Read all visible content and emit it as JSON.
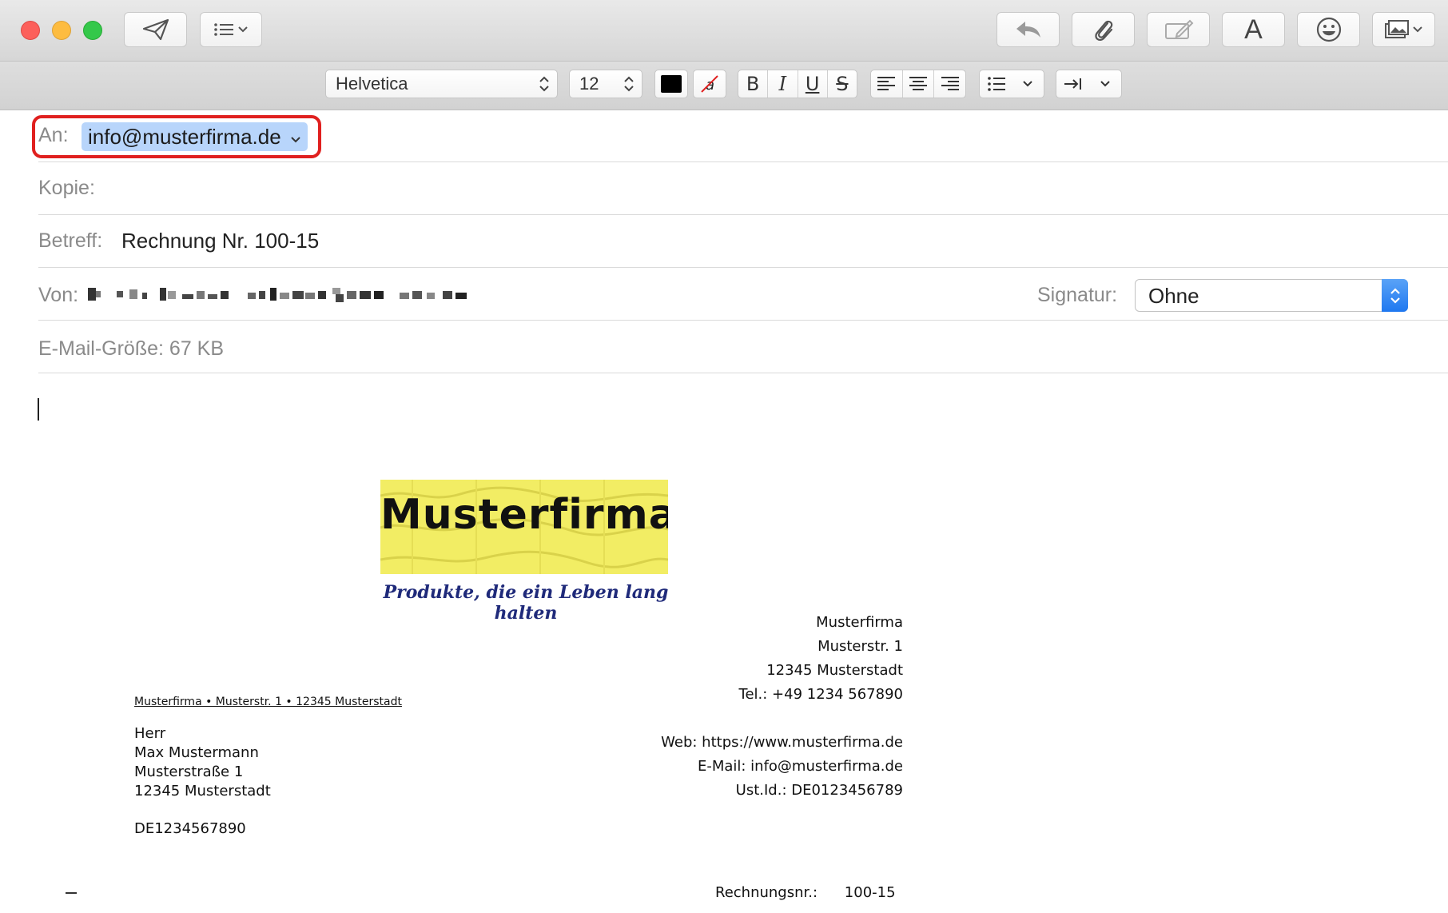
{
  "toolbar": {
    "buttons": [
      "send",
      "header-fields",
      "reply",
      "attach",
      "markup",
      "format",
      "emoji",
      "photo-browser"
    ],
    "format_glyph": "A"
  },
  "format_bar": {
    "font_family": "Helvetica",
    "font_size": "12",
    "text_color": "#000000",
    "bold": "B",
    "italic": "I",
    "underline": "U",
    "strikethrough": "S"
  },
  "header": {
    "to_label": "An:",
    "to_value": "info@musterfirma.de",
    "cc_label": "Kopie:",
    "subject_label": "Betreff:",
    "subject_value": "Rechnung Nr. 100-15",
    "from_label": "Von:",
    "signature_label": "Signatur:",
    "signature_value": "Ohne",
    "size_label": "E-Mail-Größe:",
    "size_value": "67 KB"
  },
  "document": {
    "logo_text": "Musterfirma",
    "tagline": "Produkte, die ein Leben lang halten",
    "company_block": [
      "Musterfirma",
      "Musterstr. 1",
      "12345 Musterstadt",
      "Tel.: +49 1234 567890"
    ],
    "contact_block": [
      "Web: https://www.musterfirma.de",
      "E-Mail: info@musterfirma.de",
      "Ust.Id.: DE0123456789"
    ],
    "sender_line": "Musterfirma • Musterstr. 1 • 12345 Musterstadt",
    "recipient": [
      "Herr",
      "Max Mustermann",
      "Musterstraße 1",
      "12345 Musterstadt"
    ],
    "recipient_vat": "DE1234567890",
    "invoice_label": "Rechnungsnr.:",
    "invoice_number": "100-15"
  },
  "colors": {
    "highlight_border": "#e0201f",
    "token_bg": "#b8d5fb",
    "logo_bg": "#f2ed64",
    "tagline": "#1f2a7a"
  }
}
